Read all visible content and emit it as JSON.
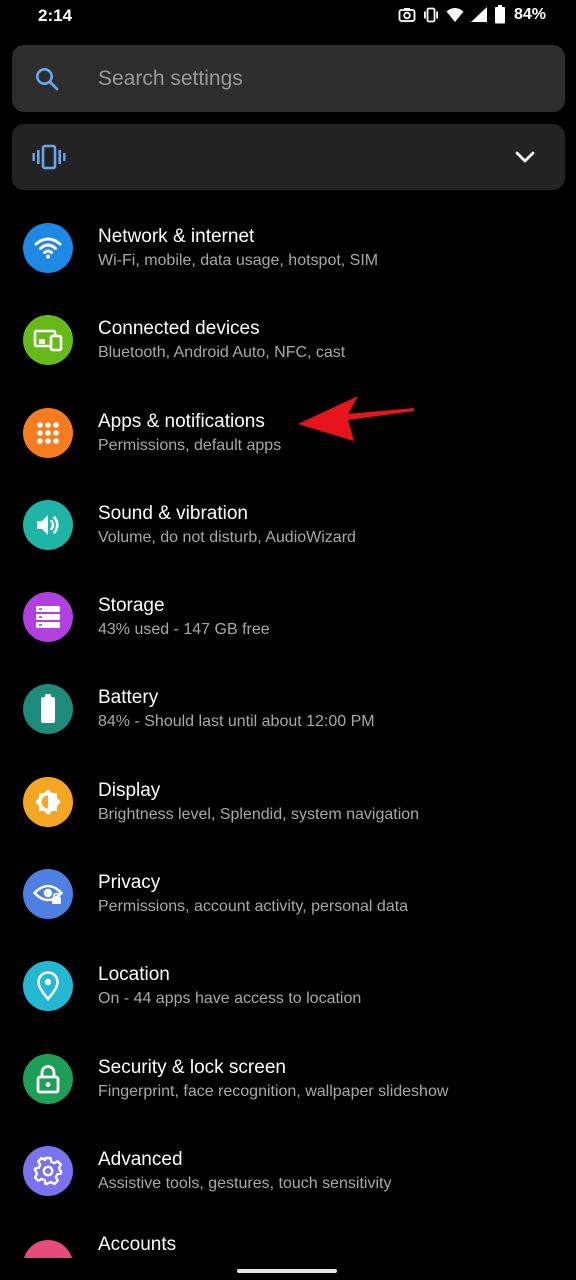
{
  "status_bar": {
    "time": "2:14",
    "battery_percent": "84%",
    "icons": [
      "screenshot-icon",
      "vibrate-icon",
      "wifi-icon",
      "signal-icon",
      "battery-icon"
    ]
  },
  "search": {
    "placeholder": "Search settings",
    "icon": "search-icon"
  },
  "mode_card": {
    "icon": "vibrate-icon",
    "expand_icon": "chevron-down-icon"
  },
  "settings": [
    {
      "id": "network",
      "title": "Network & internet",
      "subtitle": "Wi-Fi, mobile, data usage, hotspot, SIM",
      "icon": "wifi-icon",
      "color": "#1e88e5"
    },
    {
      "id": "connected",
      "title": "Connected devices",
      "subtitle": "Bluetooth, Android Auto, NFC, cast",
      "icon": "devices-icon",
      "color": "#66bb1a"
    },
    {
      "id": "apps",
      "title": "Apps & notifications",
      "subtitle": "Permissions, default apps",
      "icon": "apps-grid-icon",
      "color": "#f57c1f"
    },
    {
      "id": "sound",
      "title": "Sound & vibration",
      "subtitle": "Volume, do not disturb, AudioWizard",
      "icon": "volume-icon",
      "color": "#1fb5a6"
    },
    {
      "id": "storage",
      "title": "Storage",
      "subtitle": "43% used - 147 GB free",
      "icon": "storage-icon",
      "color": "#b23fe0"
    },
    {
      "id": "battery",
      "title": "Battery",
      "subtitle": "84% - Should last until about 12:00 PM",
      "icon": "battery-icon",
      "color": "#1d8a7c"
    },
    {
      "id": "display",
      "title": "Display",
      "subtitle": "Brightness level, Splendid, system navigation",
      "icon": "brightness-icon",
      "color": "#f5a623"
    },
    {
      "id": "privacy",
      "title": "Privacy",
      "subtitle": "Permissions, account activity, personal data",
      "icon": "eye-lock-icon",
      "color": "#4e7fe3"
    },
    {
      "id": "location",
      "title": "Location",
      "subtitle": "On - 44 apps have access to location",
      "icon": "location-pin-icon",
      "color": "#25b8d4"
    },
    {
      "id": "security",
      "title": "Security & lock screen",
      "subtitle": "Fingerprint, face recognition, wallpaper slideshow",
      "icon": "lock-icon",
      "color": "#1e9e57"
    },
    {
      "id": "advanced",
      "title": "Advanced",
      "subtitle": "Assistive tools, gestures, touch sensitivity",
      "icon": "gear-icon",
      "color": "#7a72ef"
    }
  ],
  "partial_item": {
    "title": "Accounts",
    "icon": "accounts-icon",
    "color": "#e84a7a"
  },
  "annotation": {
    "icon": "arrow-pointer-icon",
    "color": "#e8141c"
  }
}
